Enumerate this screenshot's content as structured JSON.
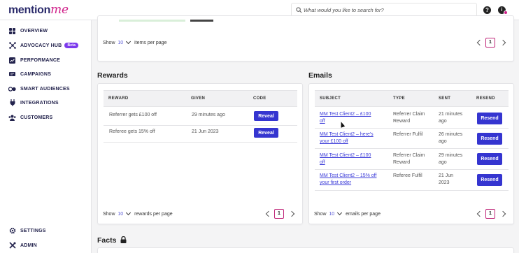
{
  "app": {
    "logo_main": "mention",
    "logo_accent": "me"
  },
  "search": {
    "placeholder": "What would you like to search for?"
  },
  "header": {
    "help": "?",
    "avatar": "i"
  },
  "sidebar": {
    "items": [
      {
        "label": "OVERVIEW",
        "icon": "grid-icon"
      },
      {
        "label": "ADVOCACY HUB",
        "icon": "network-icon",
        "badge": "Beta"
      },
      {
        "label": "PERFORMANCE",
        "icon": "chart-icon"
      },
      {
        "label": "CAMPAIGNS",
        "icon": "megaphone-icon"
      },
      {
        "label": "SMART AUDIENCES",
        "icon": "audience-icon"
      },
      {
        "label": "INTEGRATIONS",
        "icon": "plug-icon"
      },
      {
        "label": "CUSTOMERS",
        "icon": "users-icon"
      }
    ],
    "bottom": [
      {
        "label": "SETTINGS",
        "icon": "gear-icon"
      },
      {
        "label": "ADMIN",
        "icon": "tools-icon"
      }
    ]
  },
  "top_pager": {
    "show": "Show",
    "value": "10",
    "suffix": "items per page",
    "page": "1"
  },
  "rewards": {
    "title": "Rewards",
    "columns": [
      "REWARD",
      "GIVEN",
      "CODE"
    ],
    "rows": [
      {
        "reward": "Referrer gets £100 off",
        "given": "29 minutes ago",
        "action": "Reveal"
      },
      {
        "reward": "Referee gets 15% off",
        "given": "21 Jun 2023",
        "action": "Reveal"
      }
    ],
    "pager": {
      "show": "Show",
      "value": "10",
      "suffix": "rewards per page",
      "page": "1"
    }
  },
  "emails": {
    "title": "Emails",
    "columns": [
      "SUBJECT",
      "TYPE",
      "SENT",
      "RESEND"
    ],
    "rows": [
      {
        "subject_l1": "MM Test Client2 – £100",
        "subject_l2": "off",
        "type_l1": "Referrer Claim",
        "type_l2": "Reward",
        "sent_l1": "21 minutes",
        "sent_l2": "ago",
        "action": "Resend"
      },
      {
        "subject_l1": "MM Test Client2 – here's",
        "subject_l2": "your £100 off",
        "type_l1": "Referrer Fulfil",
        "type_l2": "",
        "sent_l1": "26 minutes",
        "sent_l2": "ago",
        "action": "Resend"
      },
      {
        "subject_l1": "MM Test Client2 – £100",
        "subject_l2": "off",
        "type_l1": "Referrer Claim",
        "type_l2": "Reward",
        "sent_l1": "29 minutes",
        "sent_l2": "ago",
        "action": "Resend"
      },
      {
        "subject_l1": "MM Test Client2 – 15% off",
        "subject_l2": "your first order",
        "type_l1": "Referee Fulfil",
        "type_l2": "",
        "sent_l1": "21 Jun",
        "sent_l2": "2023",
        "action": "Resend"
      }
    ],
    "pager": {
      "show": "Show",
      "value": "10",
      "suffix": "emails per page",
      "page": "1"
    }
  },
  "facts": {
    "title": "Facts"
  },
  "colors": {
    "brand": "#2b2b6b",
    "accent": "#d0218a",
    "button": "#3535d0",
    "link": "#3a3ad8"
  }
}
